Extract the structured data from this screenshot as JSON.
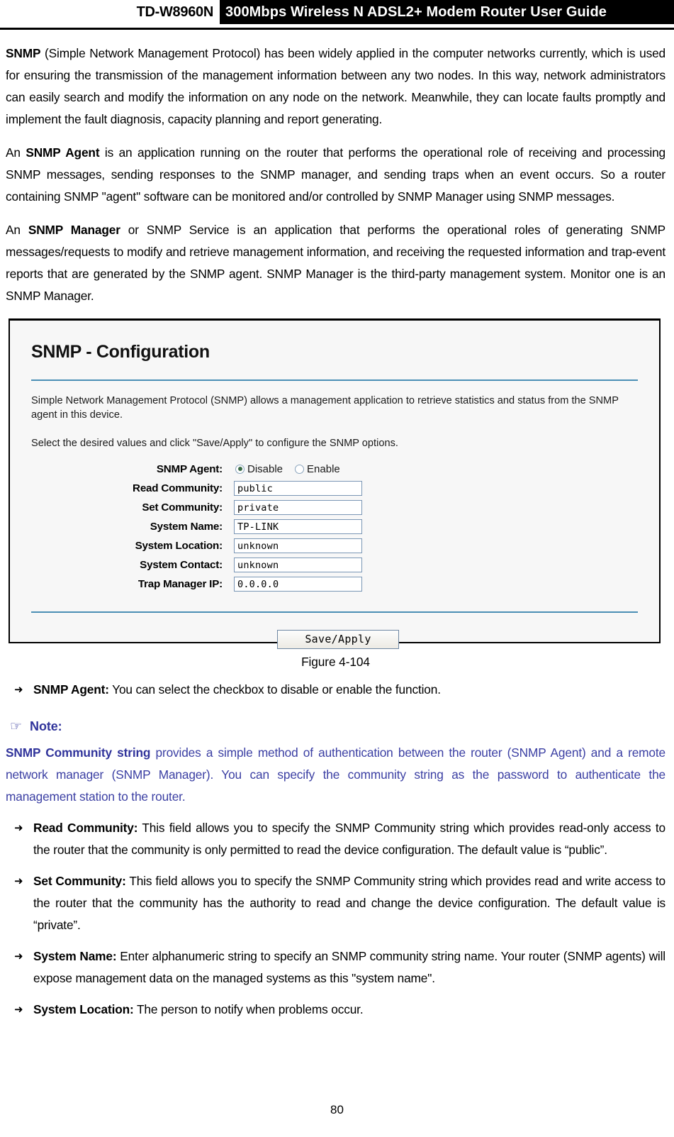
{
  "header": {
    "model": "TD-W8960N",
    "banner_title": "300Mbps Wireless N ADSL2+ Modem Router User Guide"
  },
  "intro": {
    "p1_bold": "SNMP",
    "p1_rest": " (Simple Network Management Protocol) has been widely applied in the computer networks currently, which is used for ensuring the transmission of the management information between any two nodes. In this way, network administrators can easily search and modify the information on any node on the network. Meanwhile, they can locate faults promptly and implement the fault diagnosis, capacity planning and report generating.",
    "p2_lead": "An ",
    "p2_bold": "SNMP Agent",
    "p2_rest": " is an application running on the router that performs the operational role of receiving and processing SNMP messages, sending responses to the SNMP manager, and sending traps when an event occurs. So a router containing SNMP \"agent\" software can be monitored and/or controlled by SNMP Manager using SNMP messages.",
    "p3_lead": "An ",
    "p3_bold": "SNMP Manager",
    "p3_rest": " or SNMP Service is an application that performs the operational roles of generating SNMP messages/requests to modify and retrieve management information, and receiving the requested information and trap-event reports that are generated by the SNMP agent. SNMP Manager is the third-party management system. Monitor one is an SNMP Manager."
  },
  "panel": {
    "title": "SNMP - Configuration",
    "description": "Simple Network Management Protocol (SNMP) allows a management application to retrieve statistics and status from the SNMP agent in this device.",
    "instruction": "Select the desired values and click \"Save/Apply\" to configure the SNMP options.",
    "agent_label": "SNMP Agent:",
    "agent_options": [
      {
        "label": "Disable",
        "selected": true
      },
      {
        "label": "Enable",
        "selected": false
      }
    ],
    "fields": [
      {
        "label": "Read Community:",
        "value": "public"
      },
      {
        "label": "Set Community:",
        "value": "private"
      },
      {
        "label": "System Name:",
        "value": "TP-LINK"
      },
      {
        "label": "System Location:",
        "value": "unknown"
      },
      {
        "label": "System Contact:",
        "value": "unknown"
      },
      {
        "label": "Trap Manager IP:",
        "value": "0.0.0.0"
      }
    ],
    "save_button": "Save/Apply",
    "accent_color": "#4b8fb5"
  },
  "figure_caption": "Figure 4-104",
  "bullet_agent": {
    "marker": "➜",
    "term": "SNMP Agent:",
    "text": " You can select the checkbox to disable or enable the function."
  },
  "note": {
    "icon": "☞",
    "title": "Note:",
    "body_bold": "SNMP Community string",
    "body_rest": " provides a simple method of authentication between the router (SNMP Agent) and a remote network manager (SNMP Manager). You can specify the community string as the password to authenticate the management station to the router.",
    "color": "#3b3fa3"
  },
  "bullets": [
    {
      "marker": "➜",
      "term": "Read Community:",
      "text": " This field allows you to specify the SNMP Community string which provides read-only access to the router that the community is only permitted to read the device configuration. The default value is “public”."
    },
    {
      "marker": "➜",
      "term": "Set Community:",
      "text": " This field allows you to specify the SNMP Community string which provides read and write access to the router that the community has the authority to read and change the device configuration. The default value is “private”."
    },
    {
      "marker": "➜",
      "term": "System Name:",
      "text": " Enter alphanumeric string to specify an SNMP community string name. Your router (SNMP agents) will expose management data on the managed systems as this \"system name\"."
    },
    {
      "marker": "➜",
      "term": "System Location:",
      "text": " The person to notify when problems occur."
    }
  ],
  "page_number": "80"
}
